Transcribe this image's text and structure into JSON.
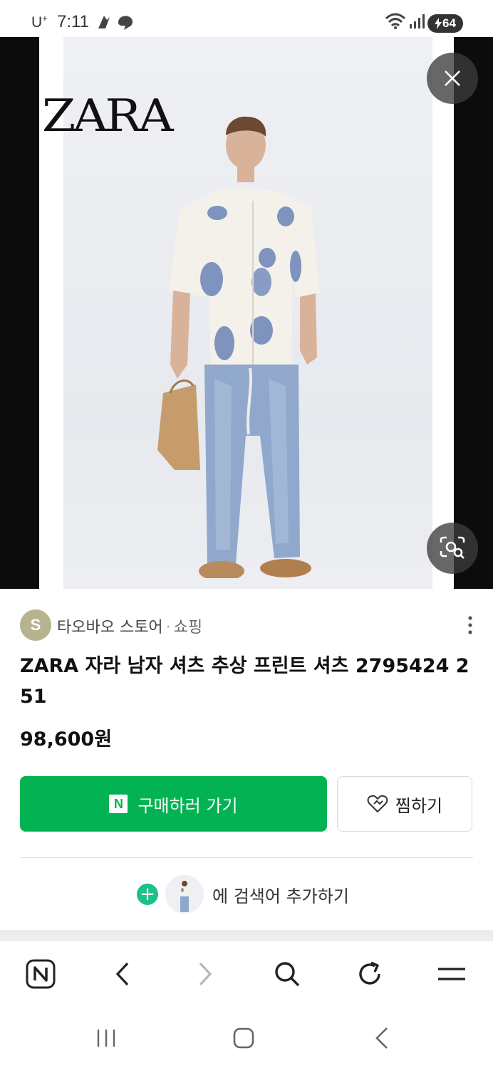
{
  "status_bar": {
    "carrier": "U",
    "carrier_sup": "+",
    "time": "7:11",
    "battery": "64"
  },
  "viewer": {
    "brand_logo": "ZARA",
    "icons": [
      "close-icon",
      "lens-search-icon"
    ]
  },
  "store": {
    "avatar_letter": "S",
    "name": "타오바오 스토어",
    "separator": "·",
    "category": "쇼핑"
  },
  "product": {
    "title": "ZARA 자라 남자 셔츠 추상 프린트 셔츠 2795424 251",
    "price": "98,600원"
  },
  "actions": {
    "buy_label": "구매하러 가기",
    "buy_badge": "N",
    "wish_label": "찜하기",
    "keyword_label": "에 검색어 추가하기"
  },
  "toolbar": {
    "items": [
      "naver-home-icon",
      "back-icon",
      "forward-icon",
      "search-icon",
      "refresh-icon",
      "menu-icon"
    ],
    "home_badge": "N"
  },
  "system_nav": {
    "items": [
      "recent-apps-icon",
      "home-icon",
      "back-icon"
    ]
  },
  "colors": {
    "accent_green": "#03b353",
    "plus_green": "#1ec08a",
    "avatar": "#b7b38f"
  }
}
